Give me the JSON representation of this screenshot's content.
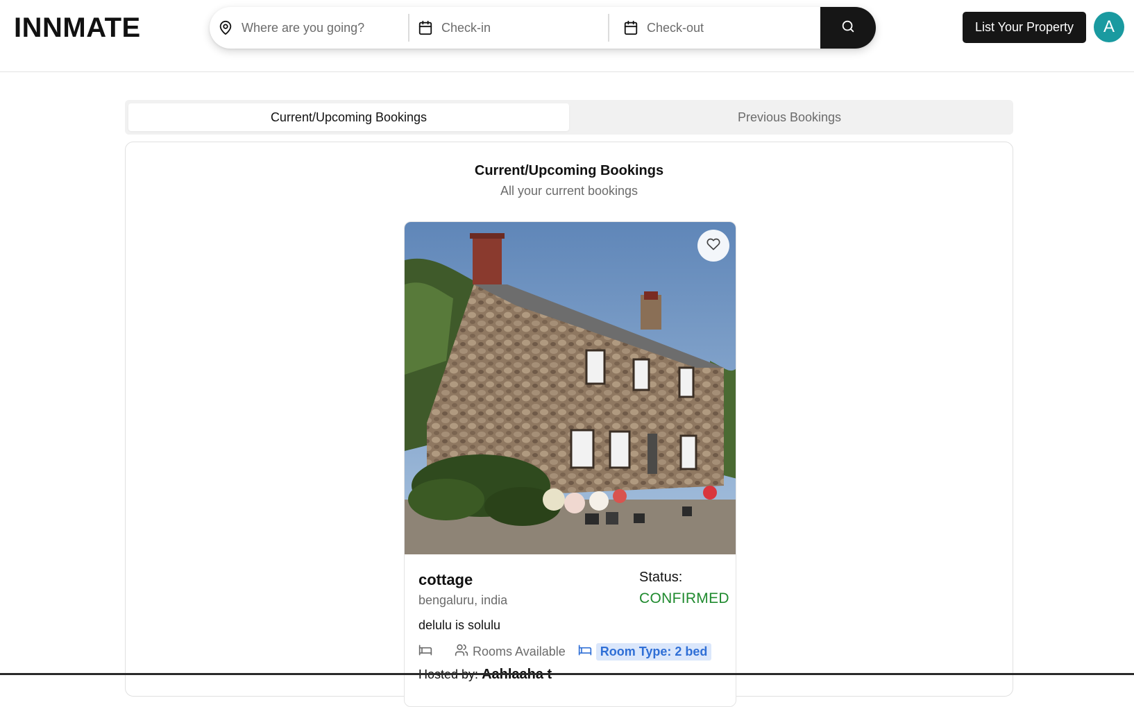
{
  "header": {
    "logo": "INNMATE",
    "search": {
      "where_placeholder": "Where are you going?",
      "checkin_placeholder": "Check-in",
      "checkout_placeholder": "Check-out"
    },
    "list_property_label": "List Your Property",
    "avatar_initial": "A"
  },
  "tabs": [
    {
      "label": "Current/Upcoming Bookings",
      "active": true
    },
    {
      "label": "Previous Bookings",
      "active": false
    }
  ],
  "panel": {
    "title": "Current/Upcoming Bookings",
    "subtitle": "All your current bookings"
  },
  "booking": {
    "name": "cottage",
    "location": "bengaluru, india",
    "description": "delulu is solulu",
    "status_label": "Status:",
    "status_value": "CONFIRMED",
    "rooms_label": "Rooms Available",
    "room_type": "Room Type: 2 bed",
    "hosted_prefix": "Hosted by:",
    "host_name": "Aahlaaha t"
  },
  "colors": {
    "status_confirmed": "#1f8a2e",
    "room_type_bg": "#dbe7fb",
    "room_type_text": "#2f6fd6",
    "avatar_bg": "#1a9aa0",
    "button_bg": "#161616"
  }
}
